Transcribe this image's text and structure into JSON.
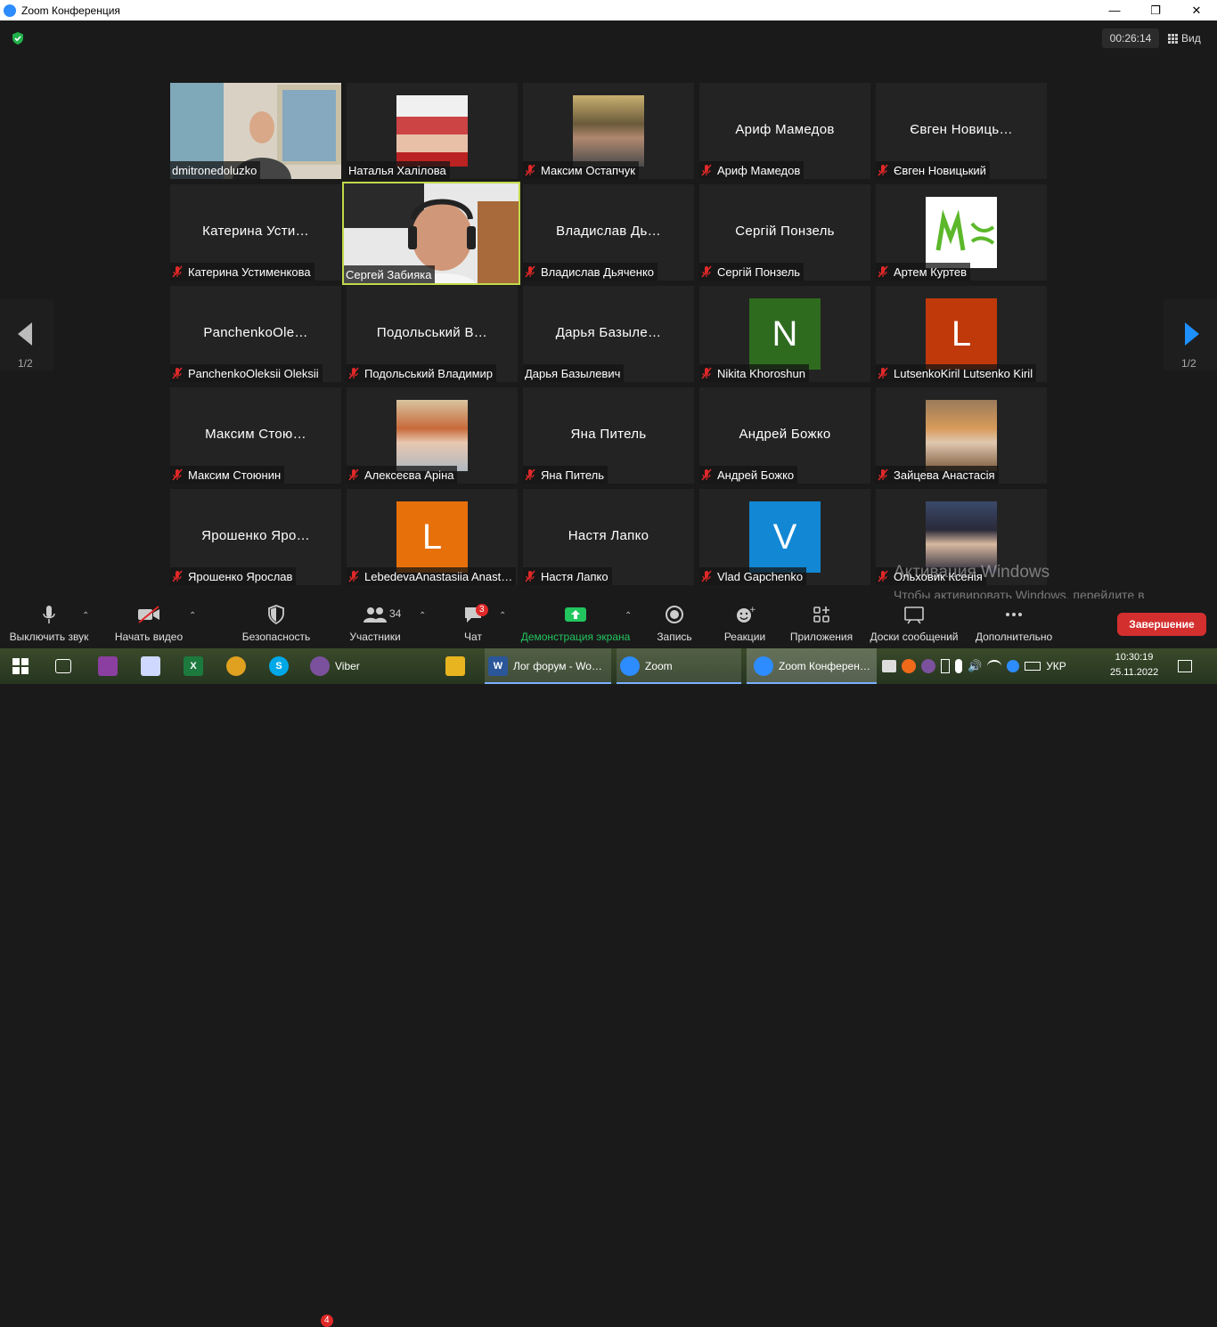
{
  "window": {
    "title": "Zoom Конференция"
  },
  "topbar": {
    "timer": "00:26:14",
    "view_label": "Вид"
  },
  "pagination": {
    "left": "1/2",
    "right": "1/2"
  },
  "participants": [
    {
      "label": "dmitronedoluzko",
      "display": "",
      "type": "video",
      "muted": false
    },
    {
      "label": "Наталья Халілова",
      "display": "",
      "type": "photo",
      "muted": false
    },
    {
      "label": "Максим Остапчук",
      "display": "",
      "type": "photo",
      "muted": true
    },
    {
      "label": "Ариф Мамедов",
      "display": "Ариф Мамедов",
      "type": "name",
      "muted": true
    },
    {
      "label": "Євген Новицький",
      "display": "Євген  Новиць…",
      "type": "name",
      "muted": true
    },
    {
      "label": "Катерина Устименкова",
      "display": "Катерина  Усти…",
      "type": "name",
      "muted": true
    },
    {
      "label": "Сергей Забияка",
      "display": "",
      "type": "video",
      "muted": false
    },
    {
      "label": "Владислав Дьяченко",
      "display": "Владислав  Дь…",
      "type": "name",
      "muted": true
    },
    {
      "label": "Сергій Понзель",
      "display": "Сергій Понзель",
      "type": "name",
      "muted": true
    },
    {
      "label": "Артем Куртев",
      "display": "",
      "type": "logo",
      "muted": true
    },
    {
      "label": "PanchenkoOleksii Oleksii",
      "display": "PanchenkoOle…",
      "type": "name",
      "muted": true
    },
    {
      "label": "Подольський Владимир",
      "display": "Подольський  В…",
      "type": "name",
      "muted": true
    },
    {
      "label": "Дарья Базылевич",
      "display": "Дарья  Базыле…",
      "type": "name",
      "muted": false
    },
    {
      "label": "Nikita Khoroshun",
      "display": "N",
      "type": "avatar",
      "color": "#2e6b1f",
      "muted": true
    },
    {
      "label": "LutsenkoKiril Lutsenko Kiril",
      "display": "L",
      "type": "avatar",
      "color": "#c0390b",
      "muted": true
    },
    {
      "label": "Максим Стоюнин",
      "display": "Максим  Стою…",
      "type": "name",
      "muted": true
    },
    {
      "label": "Алексеєва Аріна",
      "display": "",
      "type": "photo",
      "muted": true
    },
    {
      "label": "Яна Питель",
      "display": "Яна Питель",
      "type": "name",
      "muted": true
    },
    {
      "label": "Андрей Божко",
      "display": "Андрей Божко",
      "type": "name",
      "muted": true
    },
    {
      "label": "Зайцева Анастасія",
      "display": "",
      "type": "photo",
      "muted": true
    },
    {
      "label": "Ярошенко Ярослав",
      "display": "Ярошенко  Яро…",
      "type": "name",
      "muted": true
    },
    {
      "label": "LebedevaAnastasiia Anast…",
      "display": "L",
      "type": "avatar",
      "color": "#e8700a",
      "muted": true
    },
    {
      "label": "Настя Лапко",
      "display": "Настя Лапко",
      "type": "name",
      "muted": true
    },
    {
      "label": "Vlad Gapchenko",
      "display": "V",
      "type": "avatar",
      "color": "#1287d4",
      "muted": true
    },
    {
      "label": "Ольховик Ксенія",
      "display": "",
      "type": "photo",
      "muted": true
    }
  ],
  "toolbar": {
    "mute": "Выключить звук",
    "video": "Начать видео",
    "security": "Безопасность",
    "participants": "Участники",
    "participants_count": "34",
    "chat": "Чат",
    "chat_badge": "3",
    "share": "Демонстрация экрана",
    "record": "Запись",
    "reactions": "Реакции",
    "apps": "Приложения",
    "whiteboard": "Доски сообщений",
    "more": "Дополнительно",
    "end": "Завершение"
  },
  "watermark": {
    "line1": "Активация Windows",
    "line2": "Чтобы активировать Windows, перейдите в раздел \"Параметры\"."
  },
  "taskbar": {
    "viber": "Viber",
    "viber_badge": "4",
    "word": "Лог форум - Wo…",
    "zoom": "Zoom",
    "zoom_conf": "Zoom Конферен…",
    "lang": "УКР",
    "time": "10:30:19",
    "date": "25.11.2022"
  }
}
